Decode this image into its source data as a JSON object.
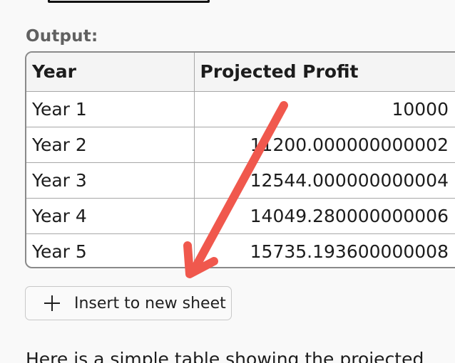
{
  "output_label": "Output:",
  "table": {
    "headers": [
      "Year",
      "Projected Profit"
    ],
    "rows": [
      [
        "Year 1",
        "10000"
      ],
      [
        "Year 2",
        "11200.000000000002"
      ],
      [
        "Year 3",
        "12544.000000000004"
      ],
      [
        "Year 4",
        "14049.280000000006"
      ],
      [
        "Year 5",
        "15735.193600000008"
      ]
    ]
  },
  "insert_button": {
    "label": "Insert to new sheet",
    "icon": "plus-icon"
  },
  "body_text": "Here is a simple table showing the projected",
  "annotation": {
    "arrow_color": "#f0584d"
  }
}
